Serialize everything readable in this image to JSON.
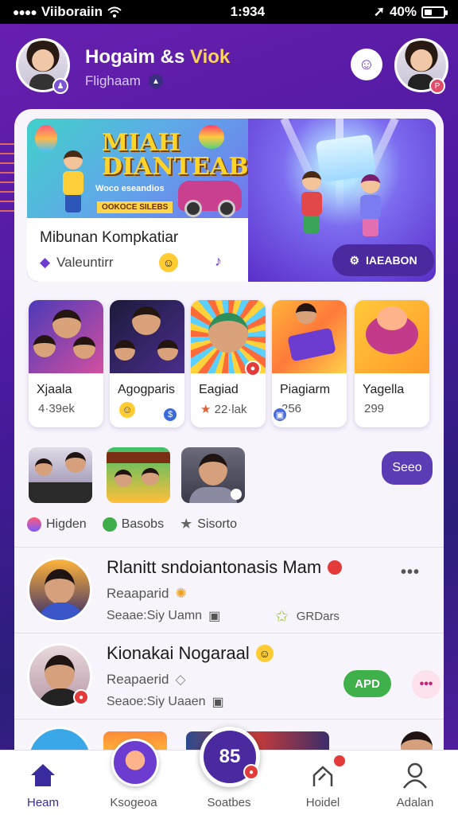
{
  "status_bar": {
    "carrier": "Viiboraiin",
    "time": "1:934",
    "battery": "40%",
    "battery_level": 0.4
  },
  "header": {
    "title_part1": "Hogaim &s",
    "title_part2": "Viok",
    "subtitle": "Flighaam",
    "colors": {
      "accent": "#ffd45c",
      "brand": "#4a2a9e"
    }
  },
  "banner": {
    "headline": "MIAH DIANTEAB",
    "tag": "Woco eseandios",
    "strip": "OOKOCE SILEBS",
    "caption_title": "Mibunan Kompkatiar",
    "caption_sub": "Valeuntirr",
    "button": "IAEABON"
  },
  "tiles": [
    {
      "label": "Xjaala",
      "count": "4·39ek"
    },
    {
      "label": "Agogparis",
      "count": ""
    },
    {
      "label": "Eagiad",
      "count": "22·lak"
    },
    {
      "label": "Piagiarm",
      "count": "256"
    },
    {
      "label": "Yagella",
      "count": "299"
    }
  ],
  "stories": {
    "see_button": "Seeo",
    "tags": [
      "Higden",
      "Basobs",
      "Sisorto"
    ]
  },
  "feed": [
    {
      "name": "Rlanitt sndoiantonasis Mam",
      "sub1": "Reaaparid",
      "sub2": "Seaae:Siy Uamn",
      "extra": "GRDars"
    },
    {
      "name": "Kionakai Nogaraal",
      "sub1": "Reapaerid",
      "sub2": "Seaoe:Siy Uaaen",
      "action": "APD"
    }
  ],
  "tabbar": {
    "items": [
      "Heam",
      "Ksogeoa",
      "Soatbes",
      "Hoidel",
      "Adalan"
    ],
    "fab": "85"
  }
}
